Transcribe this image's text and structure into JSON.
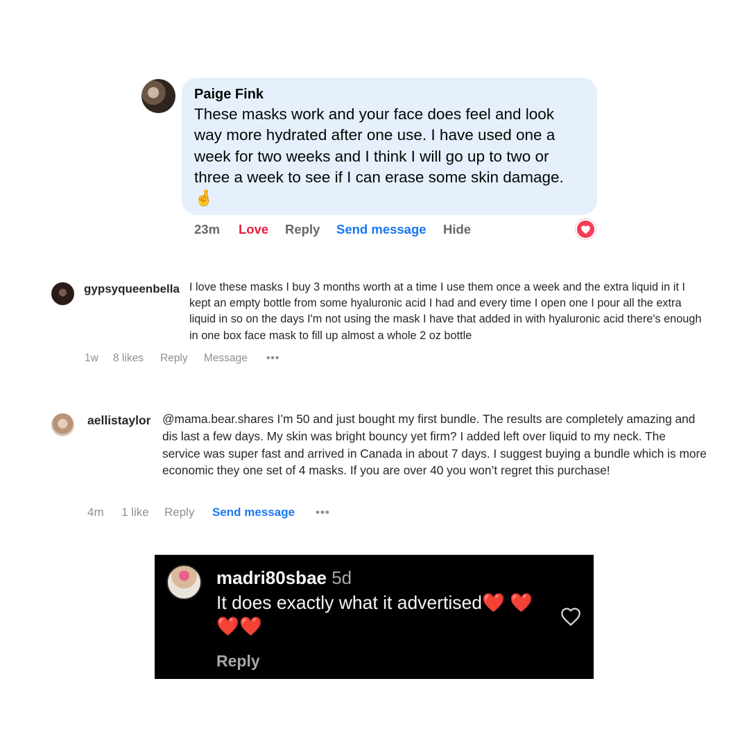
{
  "fb_comment": {
    "author": "Paige Fink",
    "text": "These masks work and your face does feel and look way more hydrated after one use. I have used one a week for two weeks and I think I will go up to two or three a week to see if I can erase some skin damage. 🤞",
    "time": "23m",
    "love_label": "Love",
    "reply_label": "Reply",
    "send_message_label": "Send message",
    "hide_label": "Hide",
    "reaction_icon": "love-reaction-icon",
    "love_color": "#e41e3f",
    "bubble_color": "#e5f0fc",
    "link_color": "#1877f2"
  },
  "ig_comment_1": {
    "username": "gypsyqueenbella",
    "text": "I love these masks I buy 3 months worth at a time I use them once a week and the extra liquid in it I kept an empty bottle from some hyaluronic acid I had and every time I open one I pour all the extra liquid in so on the days I'm not using the mask I have that added in with hyaluronic acid there's enough in one box face mask to fill up almost a whole 2 oz bottle",
    "time": "1w",
    "likes": "8 likes",
    "reply_label": "Reply",
    "message_label": "Message",
    "more_label": "•••"
  },
  "ig_comment_2": {
    "username": "aellistaylor",
    "text": "@mama.bear.shares I’m 50 and just bought my first bundle. The results are completely amazing and dis last a few days. My skin was bright bouncy yet firm? I added left over liquid to my neck. The service was super fast and arrived in Canada in about 7 days. I suggest buying a bundle which is more economic they one set of 4 masks. If you are over 40 you won’t regret this purchase!",
    "time": "4m",
    "likes": "1 like",
    "reply_label": "Reply",
    "send_message_label": "Send message",
    "more_label": "•••"
  },
  "dark_comment": {
    "username": "madri80sbae",
    "time": "5d",
    "text": "It does exactly what it advertised❤️ ❤️❤️❤️",
    "reply_label": "Reply",
    "like_icon": "heart-outline-icon"
  }
}
